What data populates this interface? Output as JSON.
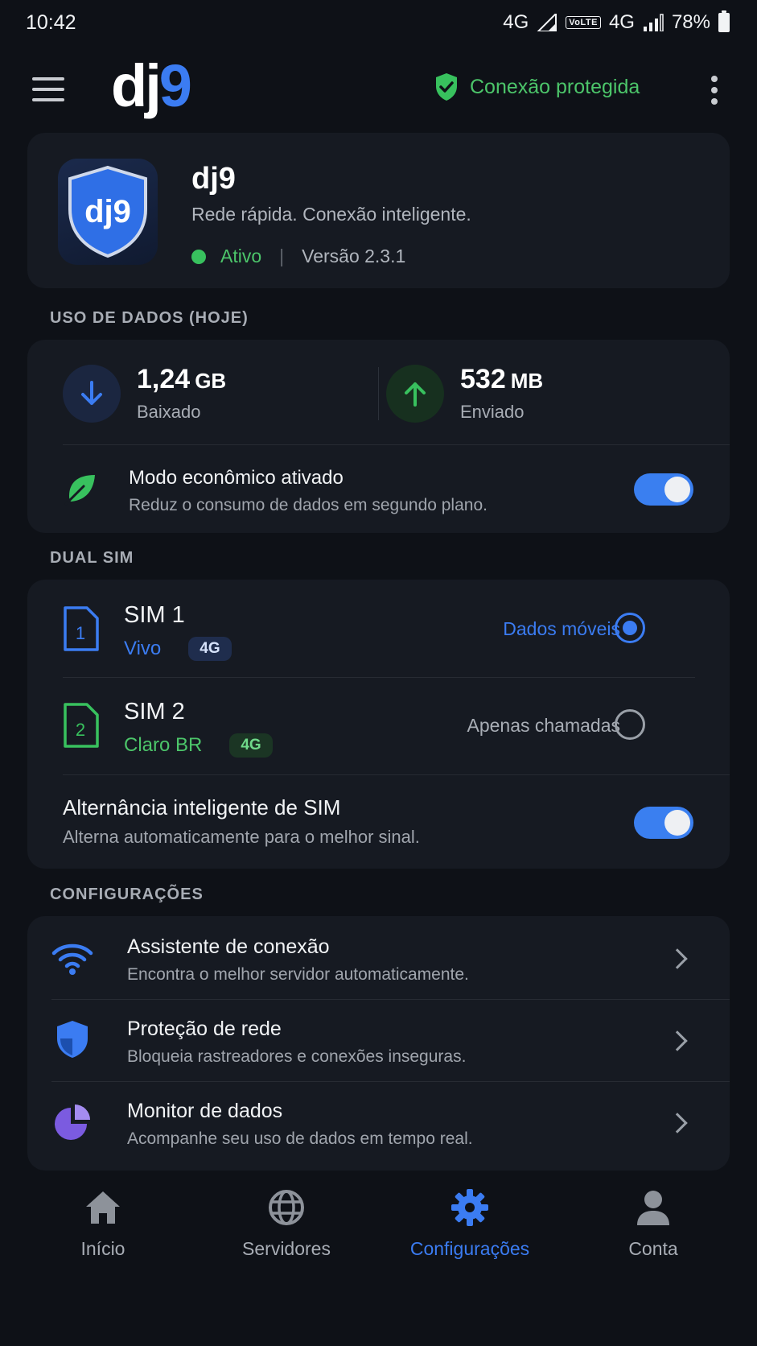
{
  "status_bar": {
    "time": "10:42",
    "net1": "4G",
    "volte": "VoLTE",
    "net2": "4G",
    "battery": "78%"
  },
  "app_bar": {
    "logo_dj": "dj",
    "logo_nine": "9",
    "protection_label": "Conexão protegida"
  },
  "app_info": {
    "icon_text": "dj9",
    "name": "dj9",
    "tagline": "Rede rápida. Conexão inteligente.",
    "status": "Ativo",
    "separator": "|",
    "version": "Versão 2.3.1"
  },
  "usage": {
    "section_title": "USO DE DADOS (HOJE)",
    "download": {
      "value": "1,24",
      "unit": "GB",
      "label": "Baixado"
    },
    "upload": {
      "value": "532",
      "unit": "MB",
      "label": "Enviado"
    },
    "eco": {
      "title": "Modo econômico ativado",
      "subtitle": "Reduz o consumo de dados em segundo plano.",
      "enabled": true
    }
  },
  "dual_sim": {
    "section_title": "DUAL SIM",
    "sims": [
      {
        "name": "SIM 1",
        "slot": "1",
        "carrier": "Vivo",
        "badge": "4G",
        "role": "Dados móveis",
        "selected": true
      },
      {
        "name": "SIM 2",
        "slot": "2",
        "carrier": "Claro BR",
        "badge": "4G",
        "role": "Apenas chamadas",
        "selected": false
      }
    ],
    "smart_switch": {
      "title": "Alternância inteligente de SIM",
      "subtitle": "Alterna automaticamente para o melhor sinal.",
      "enabled": true
    }
  },
  "settings": {
    "section_title": "CONFIGURAÇÕES",
    "items": [
      {
        "title": "Assistente de conexão",
        "subtitle": "Encontra o melhor servidor automaticamente.",
        "icon": "wifi-icon"
      },
      {
        "title": "Proteção de rede",
        "subtitle": "Bloqueia rastreadores e conexões inseguras.",
        "icon": "shield-icon"
      },
      {
        "title": "Monitor de dados",
        "subtitle": "Acompanhe seu uso de dados em tempo real.",
        "icon": "pie-chart-icon"
      }
    ]
  },
  "bottom_nav": {
    "items": [
      {
        "label": "Início",
        "active": false
      },
      {
        "label": "Servidores",
        "active": false
      },
      {
        "label": "Configurações",
        "active": true
      },
      {
        "label": "Conta",
        "active": false
      }
    ]
  },
  "colors": {
    "background": "#0e1117",
    "card": "#161a22",
    "accent_blue": "#3b7cf2",
    "accent_green": "#4cc56a",
    "purple": "#7b5be0"
  }
}
